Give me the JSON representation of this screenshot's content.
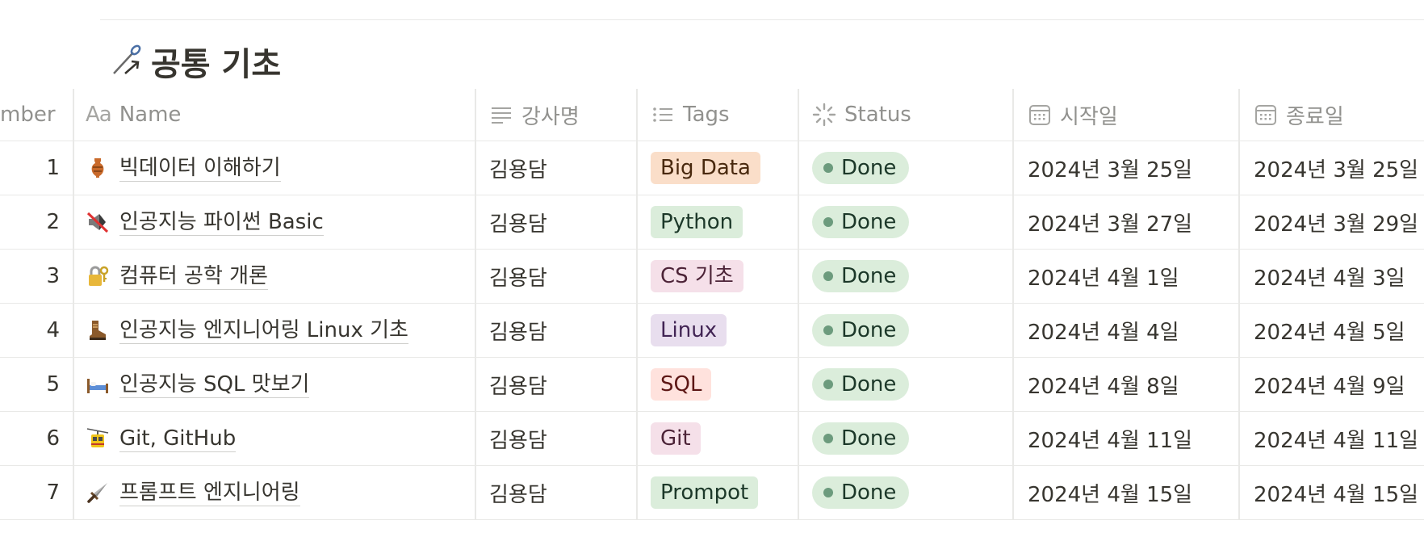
{
  "page": {
    "title": "공통 기초",
    "title_icon": "pen-arrow-icon"
  },
  "columns": {
    "number": "mber",
    "name": "Name",
    "name_type_label": "Aa",
    "instructor": "강사명",
    "tags": "Tags",
    "status": "Status",
    "start": "시작일",
    "end": "종료일"
  },
  "tag_colors": {
    "Big Data": {
      "bg": "#fadec9",
      "fg": "#49290e"
    },
    "Python": {
      "bg": "#dbeddb",
      "fg": "#1c3829"
    },
    "CS 기초": {
      "bg": "#f5e0e9",
      "fg": "#4c2337"
    },
    "Linux": {
      "bg": "#e8deee",
      "fg": "#412454"
    },
    "SQL": {
      "bg": "#ffe2dd",
      "fg": "#5d1715"
    },
    "Git": {
      "bg": "#f5e0e9",
      "fg": "#4c2337"
    },
    "Prompot": {
      "bg": "#dbeddb",
      "fg": "#1c3829"
    }
  },
  "rows": [
    {
      "number": "1",
      "icon": "amphora-icon",
      "name": "빅데이터 이해하기",
      "instructor": "김용담",
      "tag": "Big Data",
      "status": "Done",
      "start": "2024년 3월 25일",
      "end": "2024년 3월 25일"
    },
    {
      "number": "2",
      "icon": "muted-speaker-icon",
      "name": "인공지능 파이썬 Basic",
      "instructor": "김용담",
      "tag": "Python",
      "status": "Done",
      "start": "2024년 3월 27일",
      "end": "2024년 3월 29일"
    },
    {
      "number": "3",
      "icon": "locked-with-key-icon",
      "name": "컴퓨터 공학 개론",
      "instructor": "김용담",
      "tag": "CS 기초",
      "status": "Done",
      "start": "2024년 4월 1일",
      "end": "2024년 4월 3일"
    },
    {
      "number": "4",
      "icon": "hiking-boot-icon",
      "name": "인공지능 엔지니어링 Linux 기초",
      "instructor": "김용담",
      "tag": "Linux",
      "status": "Done",
      "start": "2024년 4월 4일",
      "end": "2024년 4월 5일"
    },
    {
      "number": "5",
      "icon": "bed-icon",
      "name": "인공지능 SQL 맛보기",
      "instructor": "김용담",
      "tag": "SQL",
      "status": "Done",
      "start": "2024년 4월 8일",
      "end": "2024년 4월 9일"
    },
    {
      "number": "6",
      "icon": "aerial-tramway-icon",
      "name": "Git, GitHub",
      "instructor": "김용담",
      "tag": "Git",
      "status": "Done",
      "start": "2024년 4월 11일",
      "end": "2024년 4월 11일"
    },
    {
      "number": "7",
      "icon": "dagger-icon",
      "name": "프롬프트 엔지니어링",
      "instructor": "김용담",
      "tag": "Prompot",
      "status": "Done",
      "start": "2024년 4월 15일",
      "end": "2024년 4월 15일"
    }
  ]
}
